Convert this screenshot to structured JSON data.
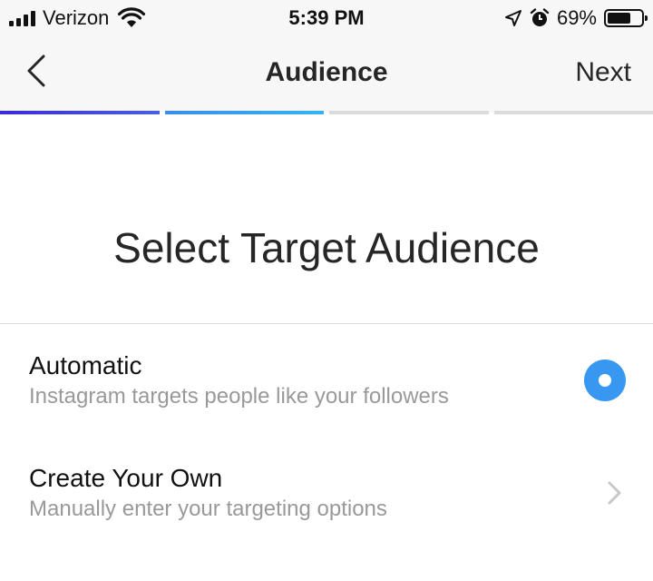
{
  "status_bar": {
    "carrier": "Verizon",
    "time": "5:39 PM",
    "battery_percent": "69%",
    "battery_level": 0.69,
    "icons": [
      "signal-icon",
      "wifi-icon",
      "location-icon",
      "alarm-icon",
      "battery-icon"
    ]
  },
  "nav": {
    "title": "Audience",
    "next_label": "Next",
    "back_icon": "chevron-left-icon"
  },
  "progress": {
    "total_steps": 4,
    "completed_steps": 2,
    "colors": [
      "#3b2bd6",
      "#3b8de8"
    ]
  },
  "main": {
    "heading": "Select Target Audience",
    "options": [
      {
        "title": "Automatic",
        "subtitle": "Instagram targets people like your followers",
        "control": "radio-selected"
      },
      {
        "title": "Create Your Own",
        "subtitle": "Manually enter your targeting options",
        "control": "chevron-right-icon"
      }
    ]
  },
  "colors": {
    "accent": "#3897f0",
    "subtitle": "#999999",
    "divider": "#dbdbdb",
    "header_bg": "#f7f7f7"
  }
}
